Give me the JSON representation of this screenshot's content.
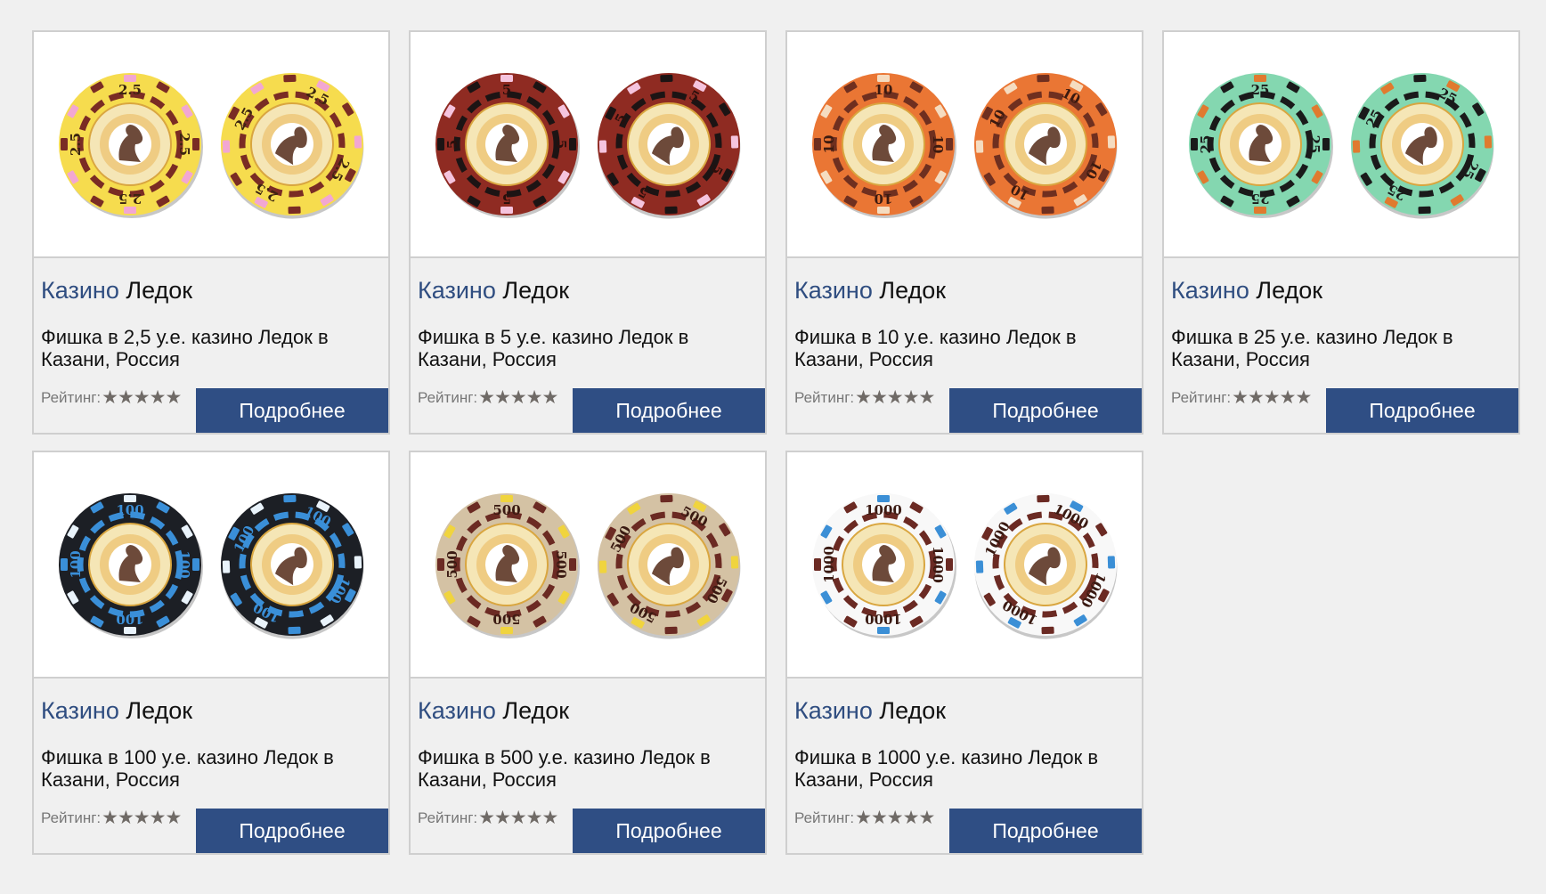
{
  "rating_label": "Рейтинг:",
  "stars": "★★★★★",
  "more_label": "Подробнее",
  "cards": [
    {
      "brand": "Казино",
      "place": "Ледок",
      "description": "Фишка в 2,5 у.е. казино Ледок в Казани, Россия",
      "chip_value": "2.5",
      "chip_colors": {
        "base": "#f6dc4e",
        "ring": "#7a2c24",
        "accent": "#f2a7d2",
        "text": "#3a2410"
      }
    },
    {
      "brand": "Казино",
      "place": "Ледок",
      "description": "Фишка в 5 у.е. казино Ледок в Казани, Россия",
      "chip_value": "5",
      "chip_colors": {
        "base": "#8f2b22",
        "ring": "#1c1414",
        "accent": "#f5c4de",
        "text": "#2a0f0c"
      }
    },
    {
      "brand": "Казино",
      "place": "Ледок",
      "description": "Фишка в 10 у.е. казино Ледок в Казани, Россия",
      "chip_value": "10",
      "chip_colors": {
        "base": "#ea7634",
        "ring": "#6f2f1f",
        "accent": "#f5dcc0",
        "text": "#3b1a10"
      }
    },
    {
      "brand": "Казино",
      "place": "Ледок",
      "description": "Фишка в 25 у.е. казино Ледок в Казани, Россия",
      "chip_value": "25",
      "chip_colors": {
        "base": "#84d7b0",
        "ring": "#1a1a1a",
        "accent": "#e07a2f",
        "text": "#1a1a1a"
      }
    },
    {
      "brand": "Казино",
      "place": "Ледок",
      "description": "Фишка в 100 у.е. казино Ледок в Казани, Россия",
      "chip_value": "100",
      "chip_colors": {
        "base": "#1c1f25",
        "ring": "#3a8fd8",
        "accent": "#e9f3fb",
        "text": "#3a8fd8"
      }
    },
    {
      "brand": "Казино",
      "place": "Ледок",
      "description": "Фишка в 500 у.е. казино Ледок в Казани, Россия",
      "chip_value": "500",
      "chip_colors": {
        "base": "#d4c2a4",
        "ring": "#6b2a23",
        "accent": "#f0d43e",
        "text": "#3a1a12"
      }
    },
    {
      "brand": "Казино",
      "place": "Ледок",
      "description": "Фишка в 1000 у.е. казино Ледок в Казани, Россия",
      "chip_value": "1000",
      "chip_colors": {
        "base": "#f8f8f8",
        "ring": "#6b2a23",
        "accent": "#3b8fd6",
        "text": "#3a1a12"
      }
    }
  ]
}
